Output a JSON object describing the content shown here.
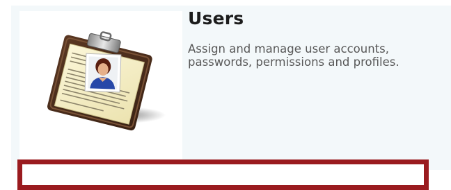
{
  "item": {
    "title": "Users",
    "description": "Assign and manage user accounts, passwords, permissions and profiles.",
    "icon": "clipboard-user-icon"
  },
  "colors": {
    "panel_background": "#f3f8fa",
    "title": "#1c1c1c",
    "description": "#585858",
    "highlight_border": "#9a1b1f"
  }
}
